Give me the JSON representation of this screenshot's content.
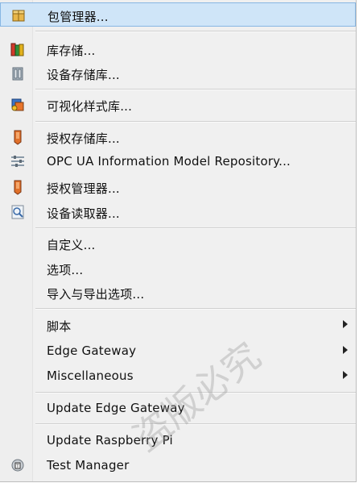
{
  "menu": {
    "items": [
      {
        "label": "包管理器...",
        "icon": "package-manager-icon"
      },
      {
        "label": "库存储...",
        "icon": "library-store-icon"
      },
      {
        "label": "设备存储库...",
        "icon": "device-repository-icon"
      },
      {
        "label": "可视化样式库...",
        "icon": "visualization-style-icon"
      },
      {
        "label": "授权存储库...",
        "icon": "license-repository-icon"
      },
      {
        "label": "OPC UA Information Model Repository...",
        "icon": "opc-ua-icon"
      },
      {
        "label": "授权管理器...",
        "icon": "license-manager-icon"
      },
      {
        "label": "设备读取器...",
        "icon": "device-reader-icon"
      },
      {
        "label": "自定义..."
      },
      {
        "label": "选项..."
      },
      {
        "label": "导入与导出选项..."
      },
      {
        "label": "脚本",
        "submenu": true
      },
      {
        "label": "Edge Gateway",
        "submenu": true
      },
      {
        "label": "Miscellaneous",
        "submenu": true
      },
      {
        "label": "Update Edge Gateway"
      },
      {
        "label": "Update Raspberry Pi"
      },
      {
        "label": "Test Manager",
        "icon": "test-manager-icon"
      }
    ]
  },
  "watermark": {
    "text": "盗版必究"
  },
  "colors": {
    "highlight": "#cfe5f8",
    "highlight_border": "#87b6e3",
    "menu_bg": "#f0f0f0"
  }
}
